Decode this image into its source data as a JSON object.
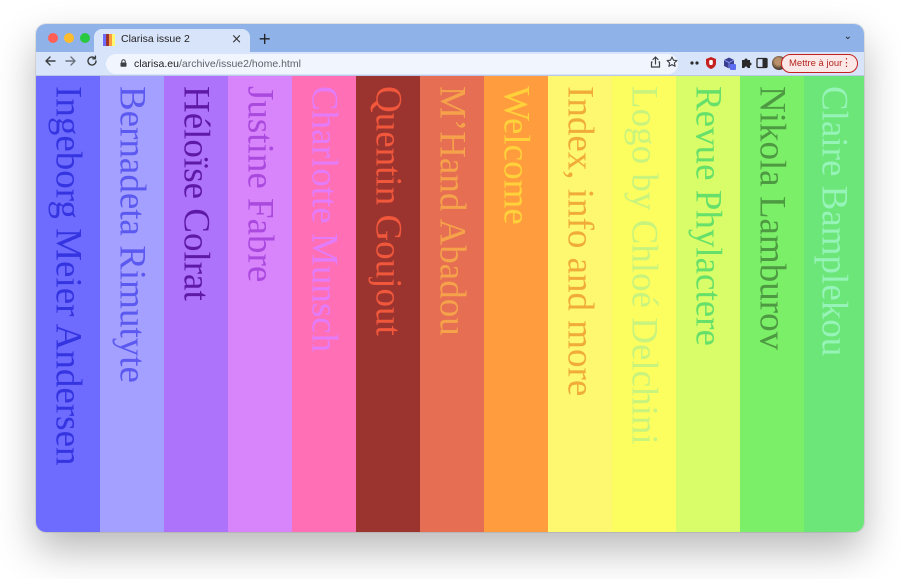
{
  "browser": {
    "tab_title": "Clarisa issue 2",
    "tab_close": "×",
    "new_tab": "+",
    "tab_menu": "⌄",
    "url_host": "clarisa.eu",
    "url_path": "/archive/issue2/home.html",
    "update_label": "Mettre à jour",
    "update_menu": "⋮",
    "icons": {
      "back": "arrow-left-icon",
      "forward": "arrow-right-icon",
      "reload": "reload-icon",
      "lock": "lock-icon",
      "share": "share-icon",
      "bookmark": "star-icon",
      "extensions": "puzzle-icon",
      "side_panel": "side-panel-icon",
      "profile": "avatar"
    }
  },
  "stripes": [
    {
      "label": "Ingeborg Meier Andersen",
      "bg": "#6e6bff",
      "fg": "#3434e0"
    },
    {
      "label": "Bernadeta Rimutyte",
      "bg": "#a3a0ff",
      "fg": "#5c59f0"
    },
    {
      "label": "Héloïse Colrat",
      "bg": "#ad73fb",
      "fg": "#5e1aa6"
    },
    {
      "label": "Justine Fabre",
      "bg": "#d884fb",
      "fg": "#a949de"
    },
    {
      "label": "Charlotte Munsch",
      "bg": "#ff6fb5",
      "fg": "#e37cfb"
    },
    {
      "label": "Quentin Goujout",
      "bg": "#9b332f",
      "fg": "#f0573b"
    },
    {
      "label": "M’Hand Abadou",
      "bg": "#e66e52",
      "fg": "#f5a24b"
    },
    {
      "label": "Welcome",
      "bg": "#ff9d3e",
      "fg": "#ffd13a"
    },
    {
      "label": "Index, info and more",
      "bg": "#fdf86f",
      "fg": "#f0ab38"
    },
    {
      "label": "Logo by Chloé Delchini",
      "bg": "#fcfe5f",
      "fg": "#c8f37d"
    },
    {
      "label": "Revue Phylactere",
      "bg": "#d9fd68",
      "fg": "#66e06a"
    },
    {
      "label": "Nikola Lamburov",
      "bg": "#7bef67",
      "fg": "#4e9a43"
    },
    {
      "label": "Claire Bamplekou",
      "bg": "#6ce678",
      "fg": "#97f4b9"
    }
  ]
}
